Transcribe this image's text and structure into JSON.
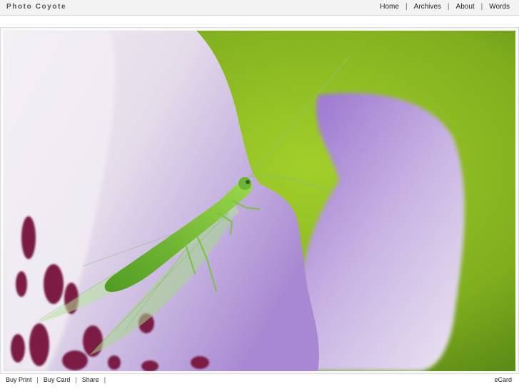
{
  "header": {
    "site_title": "Photo Coyote",
    "nav": [
      {
        "label": "Home"
      },
      {
        "label": "Archives"
      },
      {
        "label": "About"
      },
      {
        "label": "Words"
      }
    ],
    "separator": "|"
  },
  "photo": {
    "subject_icon": "photo-lacewing-on-flower",
    "colors": {
      "background_green": "#7fae1e",
      "petal_lavender": "#b39ad6",
      "petal_white": "#efeaf2",
      "spot_magenta": "#8a1f4e",
      "insect_green": "#7cc43a"
    }
  },
  "footer": {
    "actions": [
      {
        "label": "Buy Print"
      },
      {
        "label": "Buy Card"
      },
      {
        "label": "Share"
      }
    ],
    "separator": "|",
    "ecard_label": "eCard"
  }
}
